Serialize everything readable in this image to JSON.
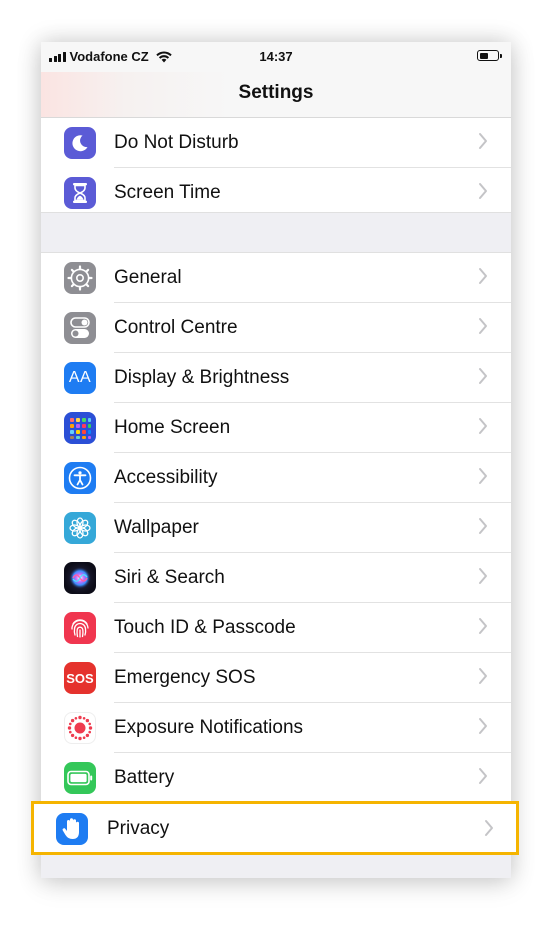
{
  "status_bar": {
    "carrier": "Vodafone CZ",
    "time": "14:37"
  },
  "nav": {
    "title": "Settings"
  },
  "group_top": [
    {
      "label": "Do Not Disturb",
      "icon": "moon-icon",
      "color": "#5b5bd6"
    },
    {
      "label": "Screen Time",
      "icon": "hourglass-icon",
      "color": "#5b5bd6"
    }
  ],
  "group_main": [
    {
      "label": "General",
      "icon": "gear-icon",
      "color": "#8e8e93"
    },
    {
      "label": "Control Centre",
      "icon": "toggles-icon",
      "color": "#8e8e93"
    },
    {
      "label": "Display & Brightness",
      "icon": "text-size-icon",
      "color": "#1e7cf2"
    },
    {
      "label": "Home Screen",
      "icon": "app-grid-icon",
      "color": "#2b4fd6"
    },
    {
      "label": "Accessibility",
      "icon": "accessibility-icon",
      "color": "#1e7cf2"
    },
    {
      "label": "Wallpaper",
      "icon": "flower-icon",
      "color": "#35a8d8"
    },
    {
      "label": "Siri & Search",
      "icon": "siri-icon",
      "color": "#1a1a2e"
    },
    {
      "label": "Touch ID & Passcode",
      "icon": "fingerprint-icon",
      "color": "#f0364f"
    },
    {
      "label": "Emergency SOS",
      "icon": "sos-icon",
      "color": "#e5322d"
    },
    {
      "label": "Exposure Notifications",
      "icon": "exposure-icon",
      "color": "#ffffff"
    },
    {
      "label": "Battery",
      "icon": "battery-icon",
      "color": "#34c759"
    }
  ],
  "highlighted": {
    "label": "Privacy",
    "icon": "hand-icon",
    "color": "#1e7cf2",
    "highlight_color": "#f5b400"
  },
  "sos_icon_text": "SOS",
  "display_icon_text": "AA"
}
